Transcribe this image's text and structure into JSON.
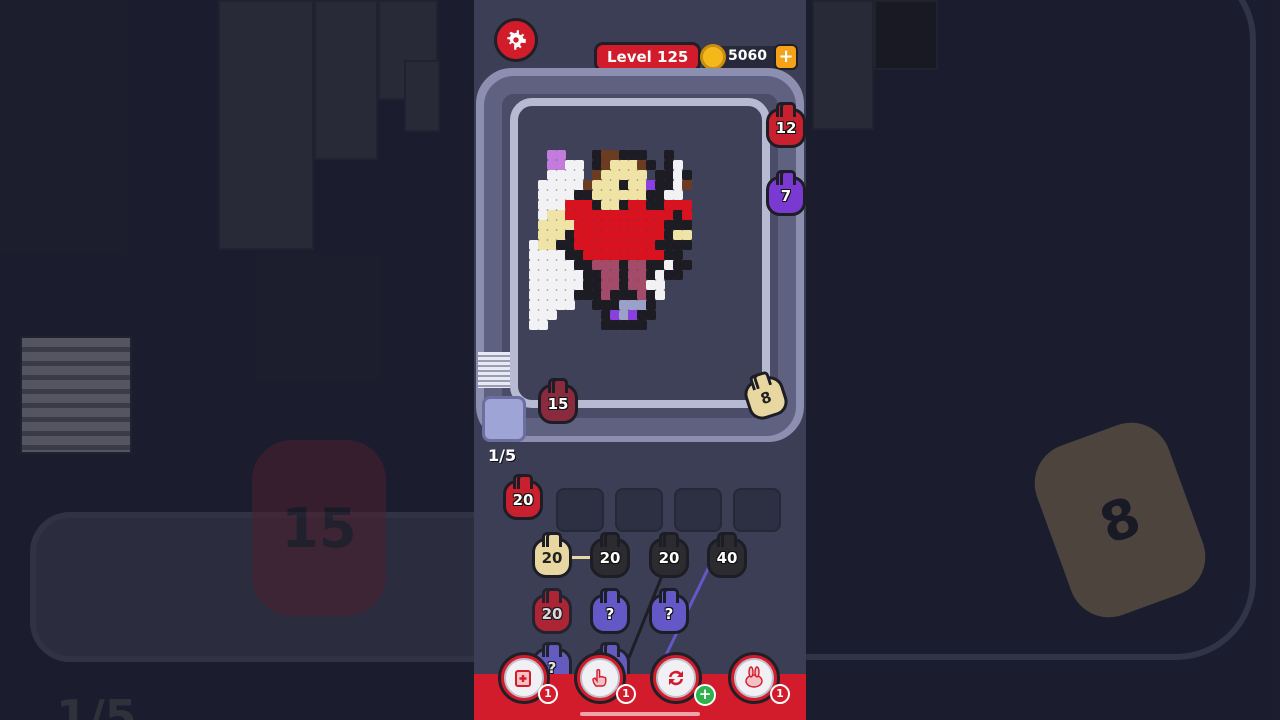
{
  "hud": {
    "level_label": "Level 125",
    "coin_value": "5060",
    "coin_plus": "+"
  },
  "conveyor": {
    "items": [
      {
        "value": "12",
        "color": "red"
      },
      {
        "value": "7",
        "color": "purple"
      },
      {
        "value": "8",
        "color": "cream"
      },
      {
        "value": "15",
        "color": "maroon"
      }
    ]
  },
  "queue": {
    "counter": "1/5",
    "slots": [
      {
        "value": "20",
        "color": "red"
      }
    ]
  },
  "grid": {
    "row1": [
      "20",
      "20",
      "20",
      "40"
    ],
    "row2": [
      "20",
      "?",
      "?"
    ],
    "row3": [
      "?",
      "?"
    ]
  },
  "boosters": [
    {
      "name": "add-slot",
      "count": "1"
    },
    {
      "name": "hand",
      "count": "1"
    },
    {
      "name": "shuffle",
      "badge": "+"
    },
    {
      "name": "magnet",
      "count": "1"
    }
  ],
  "background_zoom": {
    "left_value": "15",
    "left_counter": "1/5",
    "right_value": "8"
  },
  "colors": {
    "accent_red": "#d31c2b",
    "belt": "#8c8fb0",
    "panel": "#3c3e55"
  }
}
